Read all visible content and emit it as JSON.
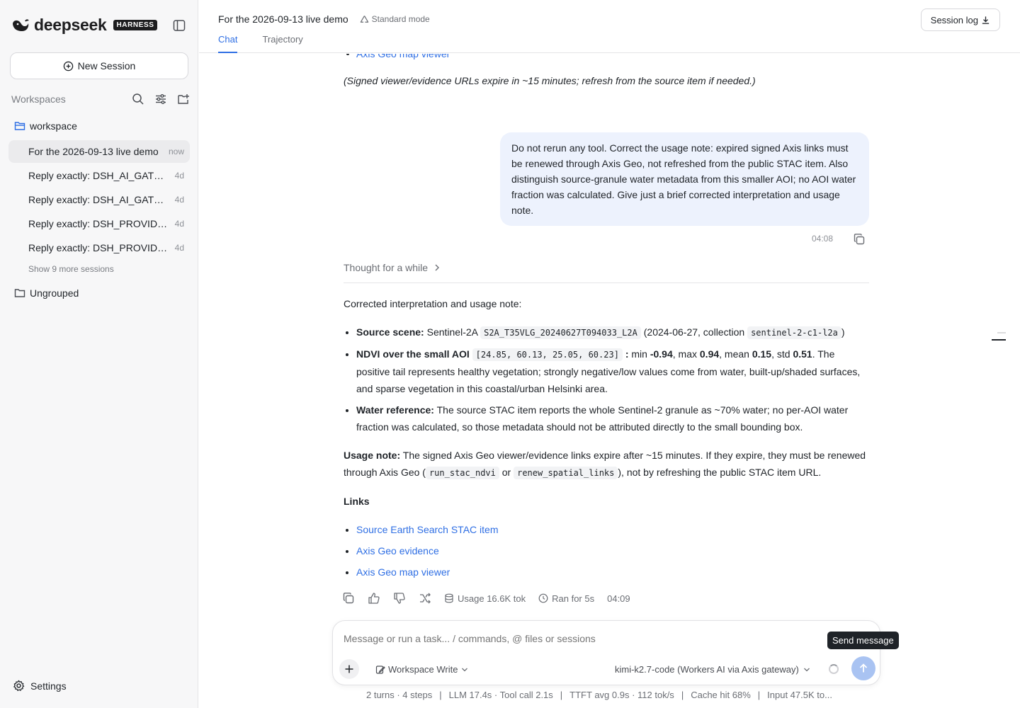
{
  "sidebar": {
    "logo_text": "deepseek",
    "logo_badge": "HARNESS",
    "new_session_label": "New Session",
    "workspaces_label": "Workspaces",
    "workspace_folder": "workspace",
    "sessions": [
      {
        "title": "For the 2026-09-13 live demo",
        "age": "now",
        "active": true
      },
      {
        "title": "Reply exactly: DSH_AI_GATEWAY_SMOKE_OK",
        "age": "4d"
      },
      {
        "title": "Reply exactly: DSH_AI_GATEWAY_SMOKE_OK",
        "age": "4d"
      },
      {
        "title": "Reply exactly: DSH_PROVIDER_SMOKE_OK",
        "age": "4d"
      },
      {
        "title": "Reply exactly: DSH_PROVIDER_SMOKE_OK",
        "age": "4d"
      }
    ],
    "show_more": "Show 9 more sessions",
    "ungrouped": "Ungrouped",
    "settings": "Settings"
  },
  "header": {
    "title": "For the 2026-09-13 live demo",
    "mode": "Standard mode",
    "tabs": [
      "Chat",
      "Trajectory"
    ],
    "session_log": "Session log"
  },
  "conversation": {
    "prev_link": "Axis Geo map viewer",
    "prev_note": "(Signed viewer/evidence URLs expire in ~15 minutes; refresh from the source item if needed.)",
    "user_message": "Do not rerun any tool. Correct the usage note: expired signed Axis links must be renewed through Axis Geo, not refreshed from the public STAC item. Also distinguish source-granule water metadata from this smaller AOI; no AOI water fraction was calculated. Give just a brief corrected interpretation and usage note.",
    "user_time": "04:08",
    "thought": "Thought for a while",
    "intro": "Corrected interpretation and usage note:",
    "b1_label": "Source scene:",
    "b1_text": "Sentinel-2A",
    "b1_code": "S2A_T35VLG_20240627T094033_L2A",
    "b1_mid": "(2024-06-27, collection",
    "b1_code2": "sentinel-2-c1-l2a",
    "b1_end": ")",
    "b2_label": "NDVI over the small AOI",
    "b2_code": "[24.85, 60.13, 25.05, 60.23]",
    "b2_colon": ":",
    "b2_t1": "min",
    "b2_min": "-0.94",
    "b2_t2": ", max",
    "b2_max": "0.94",
    "b2_t3": ", mean",
    "b2_mean": "0.15",
    "b2_t4": ", std",
    "b2_std": "0.51",
    "b2_rest": ". The positive tail represents healthy vegetation; strongly negative/low values come from water, built-up/shaded surfaces, and sparse vegetation in this coastal/urban Helsinki area.",
    "b3_label": "Water reference:",
    "b3_text": "The source STAC item reports the whole Sentinel-2 granule as ~70% water; no per-AOI water fraction was calculated, so those metadata should not be attributed directly to the small bounding box.",
    "usage_label": "Usage note:",
    "usage_text": "The signed Axis Geo viewer/evidence links expire after ~15 minutes. If they expire, they must be renewed through Axis Geo (",
    "usage_code1": "run_stac_ndvi",
    "usage_or": "or",
    "usage_code2": "renew_spatial_links",
    "usage_end": "), not by refreshing the public STAC item URL.",
    "links_title": "Links",
    "links": [
      "Source Earth Search STAC item",
      "Axis Geo evidence",
      "Axis Geo map viewer"
    ],
    "usage_tokens": "Usage 16.6K tok",
    "ran_for": "Ran for 5s",
    "answer_time": "04:09"
  },
  "composer": {
    "placeholder": "Message or run a task... / commands, @ files or sessions",
    "workspace_mode": "Workspace Write",
    "model": "kimi-k2.7-code (Workers AI via Axis gateway)",
    "send_tooltip": "Send message"
  },
  "status": {
    "turns": "2 turns · 4 steps",
    "llm": "LLM 17.4s · Tool call 2.1s",
    "ttft": "TTFT avg 0.9s · 112 tok/s",
    "cache": "Cache hit 68%",
    "input": "Input 47.5K to..."
  },
  "colors": {
    "accent": "#2f6fe4",
    "user_bubble": "#edf2fd",
    "send_button": "#a9c3f2"
  }
}
